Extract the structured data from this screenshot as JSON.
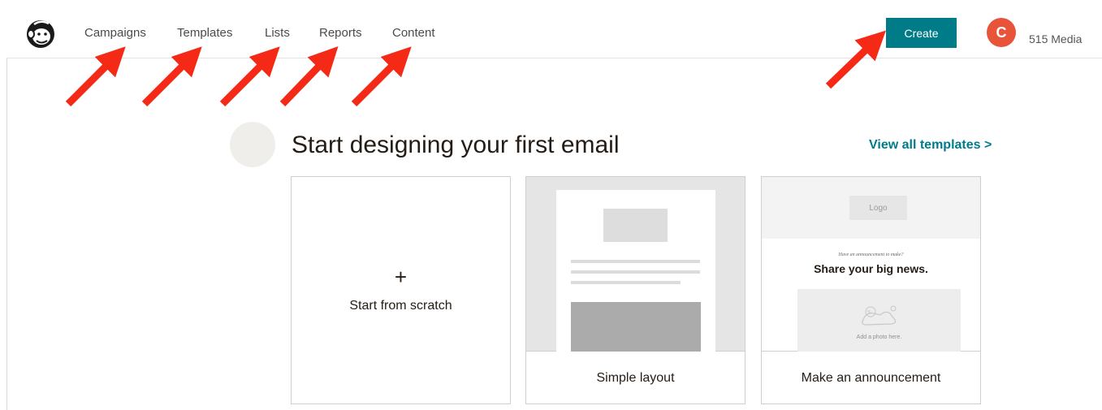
{
  "nav": {
    "items": [
      {
        "label": "Campaigns"
      },
      {
        "label": "Templates"
      },
      {
        "label": "Lists"
      },
      {
        "label": "Reports"
      },
      {
        "label": "Content"
      }
    ],
    "create_label": "Create",
    "avatar_initial": "C",
    "account_name": "515 Media",
    "logo_icon": "freddie-monkey-logo-icon"
  },
  "main": {
    "section_title": "Start designing your first email",
    "view_all_label": "View all templates >",
    "cards": [
      {
        "icon": "plus-icon",
        "symbol": "+",
        "label": "Start from scratch"
      },
      {
        "label": "Simple layout"
      },
      {
        "label": "Make an announcement",
        "preview": {
          "logo_text": "Logo",
          "small_text": "Have an announcement to make?",
          "headline": "Share your big news.",
          "photo_text": "Add a photo here."
        }
      }
    ]
  },
  "colors": {
    "accent": "#007c89",
    "avatar": "#e8543a",
    "annotation_arrow": "#f42a17"
  }
}
